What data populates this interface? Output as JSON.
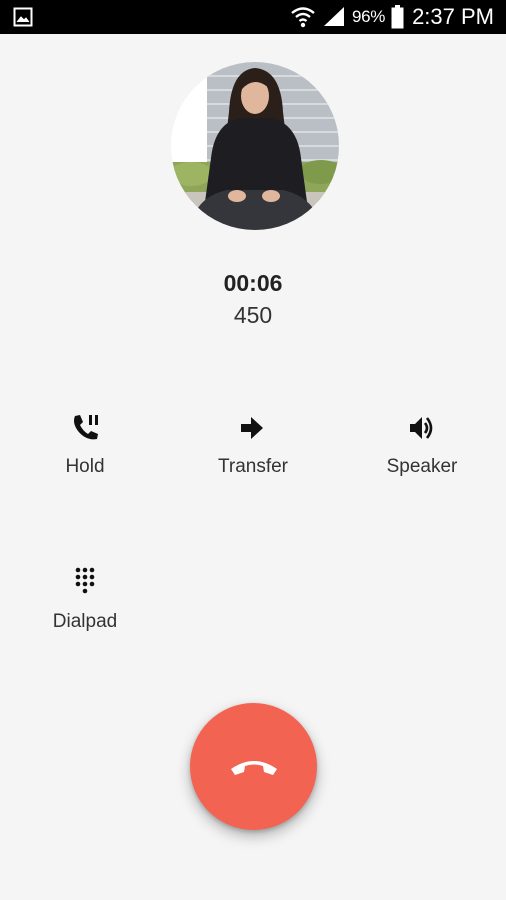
{
  "status_bar": {
    "battery_percent": "96%",
    "time": "2:37 PM",
    "icons": [
      "gallery-icon",
      "wifi-icon",
      "signal-icon",
      "battery-icon"
    ]
  },
  "call": {
    "duration": "00:06",
    "number": "450"
  },
  "actions": {
    "hold_label": "Hold",
    "transfer_label": "Transfer",
    "speaker_label": "Speaker",
    "dialpad_label": "Dialpad"
  },
  "colors": {
    "end_call": "#f26451",
    "background": "#f5f5f5",
    "status_bar": "#000000"
  }
}
